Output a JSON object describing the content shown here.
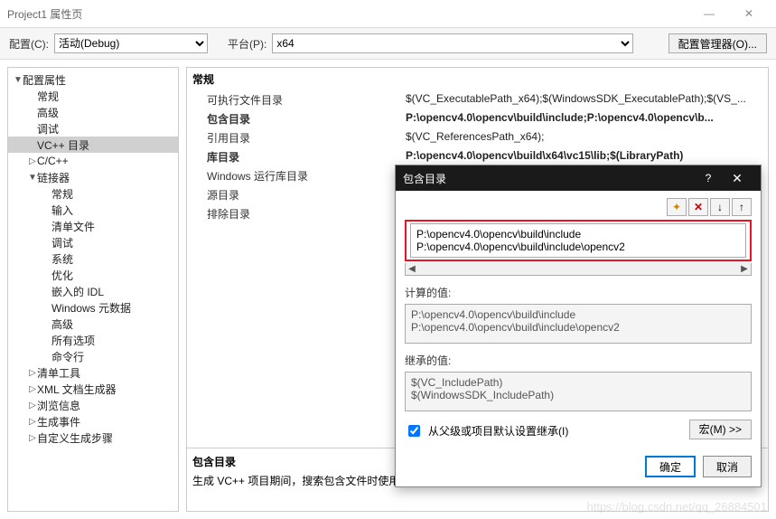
{
  "window": {
    "title": "Project1 属性页",
    "min": "—",
    "close": "✕"
  },
  "toolbar": {
    "config_label": "配置(C):",
    "config_value": "活动(Debug)",
    "platform_label": "平台(P):",
    "platform_value": "x64",
    "manager_btn": "配置管理器(O)..."
  },
  "tree": [
    {
      "indent": 0,
      "arrow": "▼",
      "label": "配置属性"
    },
    {
      "indent": 1,
      "arrow": "",
      "label": "常规"
    },
    {
      "indent": 1,
      "arrow": "",
      "label": "高级"
    },
    {
      "indent": 1,
      "arrow": "",
      "label": "调试"
    },
    {
      "indent": 1,
      "arrow": "",
      "label": "VC++ 目录",
      "sel": true
    },
    {
      "indent": 1,
      "arrow": "▷",
      "label": "C/C++"
    },
    {
      "indent": 1,
      "arrow": "▼",
      "label": "链接器"
    },
    {
      "indent": 2,
      "arrow": "",
      "label": "常规"
    },
    {
      "indent": 2,
      "arrow": "",
      "label": "输入"
    },
    {
      "indent": 2,
      "arrow": "",
      "label": "清单文件"
    },
    {
      "indent": 2,
      "arrow": "",
      "label": "调试"
    },
    {
      "indent": 2,
      "arrow": "",
      "label": "系统"
    },
    {
      "indent": 2,
      "arrow": "",
      "label": "优化"
    },
    {
      "indent": 2,
      "arrow": "",
      "label": "嵌入的 IDL"
    },
    {
      "indent": 2,
      "arrow": "",
      "label": "Windows 元数据"
    },
    {
      "indent": 2,
      "arrow": "",
      "label": "高级"
    },
    {
      "indent": 2,
      "arrow": "",
      "label": "所有选项"
    },
    {
      "indent": 2,
      "arrow": "",
      "label": "命令行"
    },
    {
      "indent": 1,
      "arrow": "▷",
      "label": "清单工具"
    },
    {
      "indent": 1,
      "arrow": "▷",
      "label": "XML 文档生成器"
    },
    {
      "indent": 1,
      "arrow": "▷",
      "label": "浏览信息"
    },
    {
      "indent": 1,
      "arrow": "▷",
      "label": "生成事件"
    },
    {
      "indent": 1,
      "arrow": "▷",
      "label": "自定义生成步骤"
    }
  ],
  "grid": {
    "group": "常规",
    "rows": [
      {
        "k": "可执行文件目录",
        "v": "$(VC_ExecutablePath_x64);$(WindowsSDK_ExecutablePath);$(VS_...",
        "b": false
      },
      {
        "k": "包含目录",
        "v": "P:\\opencv4.0\\opencv\\build\\include;P:\\opencv4.0\\opencv\\b...",
        "b": true
      },
      {
        "k": "引用目录",
        "v": "$(VC_ReferencesPath_x64);",
        "b": false
      },
      {
        "k": "库目录",
        "v": "P:\\opencv4.0\\opencv\\build\\x64\\vc15\\lib;$(LibraryPath)",
        "b": true
      },
      {
        "k": "Windows 运行库目录",
        "v": "",
        "b": false
      },
      {
        "k": "源目录",
        "v": "",
        "b": false
      },
      {
        "k": "排除目录",
        "v": "",
        "b": false
      }
    ],
    "desc_title": "包含目录",
    "desc_text": "生成 VC++ 项目期间，搜索包含文件时使用..."
  },
  "popup": {
    "title": "包含目录",
    "help": "?",
    "close": "✕",
    "tool_new": "✦",
    "tool_del": "✕",
    "tool_up": "↓",
    "tool_down": "↑",
    "paths": [
      "P:\\opencv4.0\\opencv\\build\\include",
      "P:\\opencv4.0\\opencv\\build\\include\\opencv2"
    ],
    "computed_label": "计算的值:",
    "computed": [
      "P:\\opencv4.0\\opencv\\build\\include",
      "P:\\opencv4.0\\opencv\\build\\include\\opencv2"
    ],
    "inherited_label": "继承的值:",
    "inherited": [
      "$(VC_IncludePath)",
      "$(WindowsSDK_IncludePath)"
    ],
    "inherit_checkbox": "从父级或项目默认设置继承(I)",
    "macro_btn": "宏(M) >>",
    "ok": "确定",
    "cancel": "取消"
  },
  "watermark": "https://blog.csdn.net/qq_26884501"
}
